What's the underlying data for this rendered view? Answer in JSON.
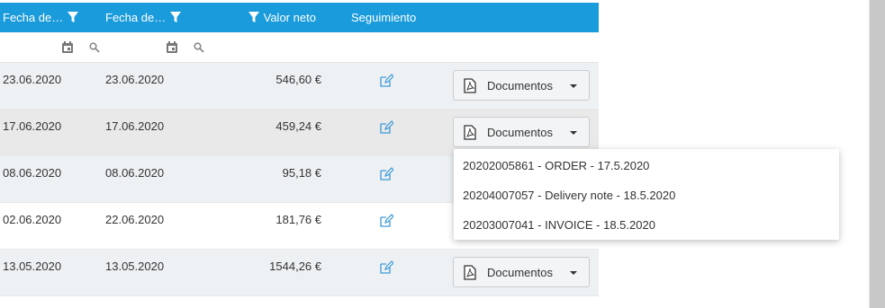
{
  "header": {
    "col1": "Fecha de…",
    "col2": "Fecha de…",
    "col3": "Valor neto",
    "col4": "Seguimiento"
  },
  "rows": [
    {
      "date1": "23.06.2020",
      "date2": "23.06.2020",
      "value": "546,60 €",
      "docs": "Documentos"
    },
    {
      "date1": "17.06.2020",
      "date2": "17.06.2020",
      "value": "459,24 €",
      "docs": "Documentos"
    },
    {
      "date1": "08.06.2020",
      "date2": "08.06.2020",
      "value": "95,18 €"
    },
    {
      "date1": "02.06.2020",
      "date2": "22.06.2020",
      "value": "181,76 €"
    },
    {
      "date1": "13.05.2020",
      "date2": "13.05.2020",
      "value": "1544,26 €",
      "docs": "Documentos"
    }
  ],
  "dropdown": {
    "items": [
      "20202005861 - ORDER - 17.5.2020",
      "20204007057 - Delivery note - 18.5.2020",
      "20203007041 - INVOICE - 18.5.2020"
    ]
  },
  "colors": {
    "header": "#1a9bdb",
    "icon": "#3d9ad6"
  },
  "icons": [
    "filter-icon",
    "calendar-icon",
    "search-icon",
    "edit-icon",
    "pdf-icon",
    "caret-down-icon"
  ]
}
